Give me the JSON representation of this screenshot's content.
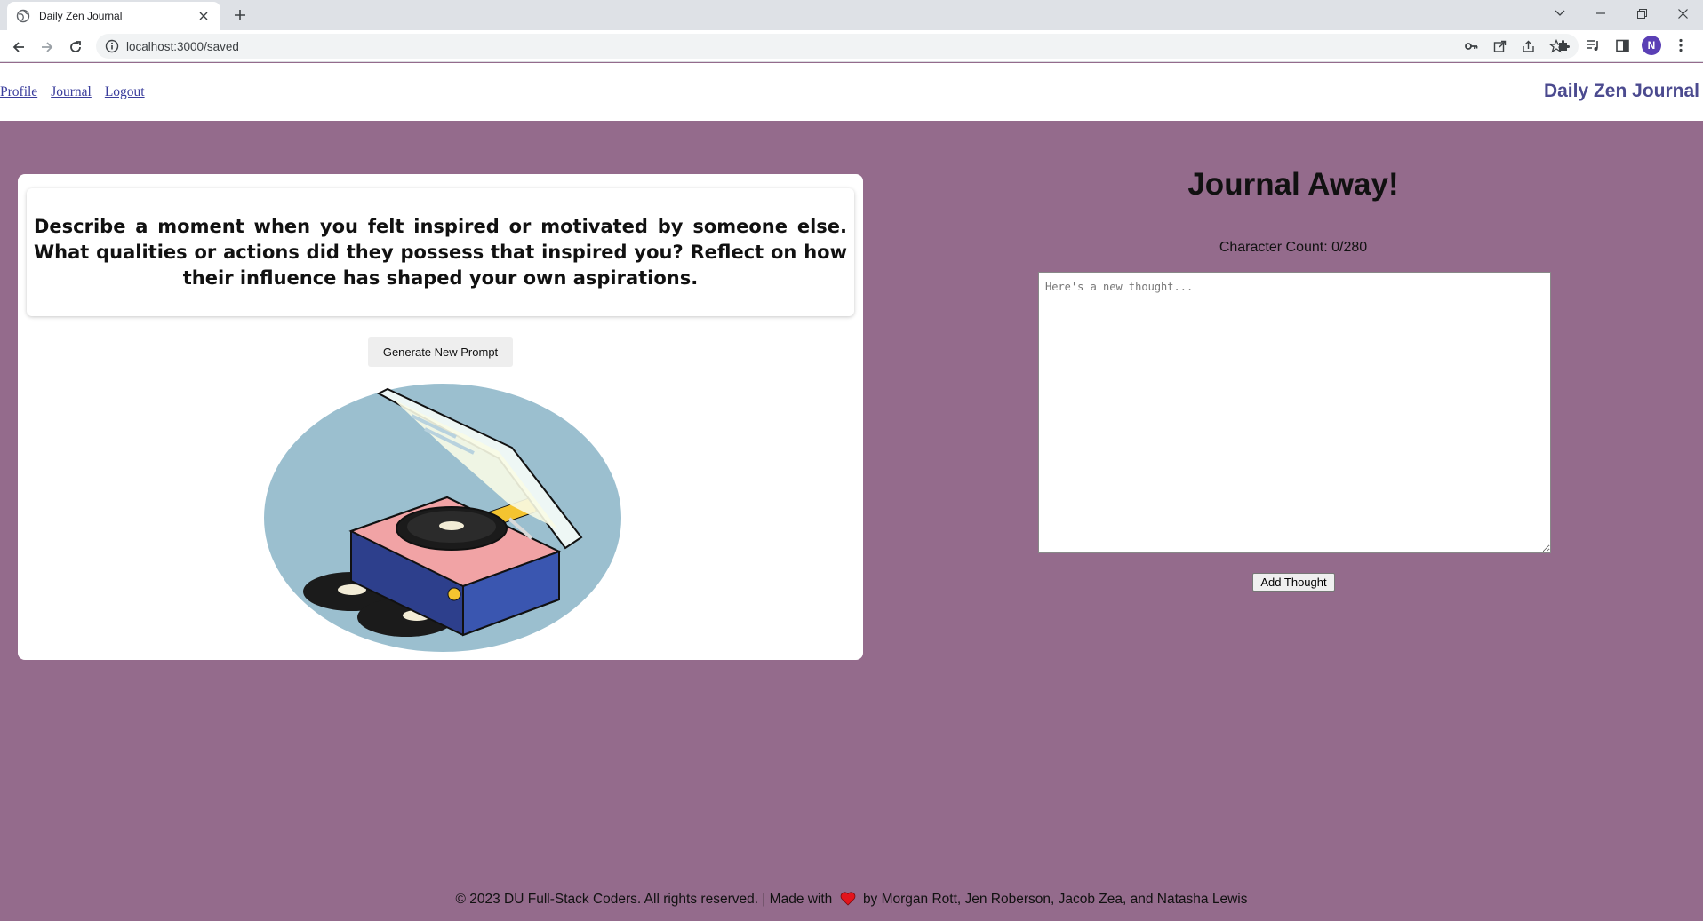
{
  "browser": {
    "tab_title": "Daily Zen Journal",
    "url": "localhost:3000/saved",
    "profile_initial": "N"
  },
  "nav": {
    "links": [
      "Profile",
      "Journal",
      "Logout"
    ],
    "brand": "Daily Zen Journal"
  },
  "prompt": {
    "text": "Describe a moment when you felt inspired or motivated by someone else. What qualities or actions did they possess that inspired you? Reflect on how their influence has shaped your own aspirations.",
    "button_label": "Generate New Prompt"
  },
  "journal": {
    "title": "Journal Away!",
    "char_count": "Character Count: 0/280",
    "placeholder": "Here's a new thought...",
    "submit_label": "Add Thought"
  },
  "footer": {
    "left": "© 2023 DU Full-Stack Coders. All rights reserved. | Made with",
    "right": "by Morgan Rott, Jen Roberson, Jacob Zea, and Natasha Lewis"
  },
  "colors": {
    "page_background": "#946b8c",
    "brand_text": "#4b4a8f",
    "link": "#3a3d9c",
    "heart": "#e3141c"
  },
  "icons": [
    "globe-icon",
    "close-icon",
    "plus-icon",
    "chevron-down-icon",
    "minimize-icon",
    "restore-icon",
    "window-close-icon",
    "back-icon",
    "forward-icon",
    "reload-icon",
    "info-icon",
    "key-icon",
    "open-external-icon",
    "share-icon",
    "star-icon",
    "puzzle-icon",
    "media-icon",
    "sidebar-icon",
    "kebab-menu-icon",
    "heart-icon"
  ]
}
